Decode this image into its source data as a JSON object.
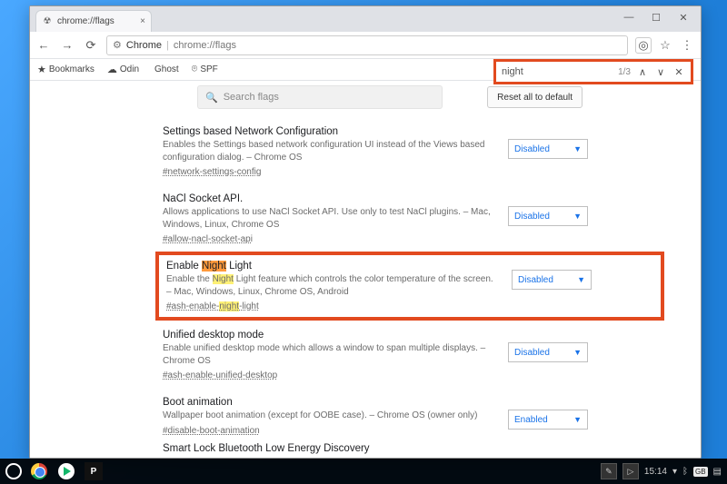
{
  "window": {
    "tab_title": "chrome://flags"
  },
  "omnibox": {
    "scheme_icon": "⚙",
    "scheme": "Chrome",
    "separator": "|",
    "path": "chrome://flags"
  },
  "bookmarks": {
    "label": "Bookmarks",
    "items": [
      {
        "icon": "☁",
        "label": "Odin"
      },
      {
        "icon": "",
        "label": "Ghost"
      },
      {
        "icon": "⌾",
        "label": "SPF"
      }
    ]
  },
  "find": {
    "query": "night",
    "count": "1/3"
  },
  "search": {
    "placeholder": "Search flags"
  },
  "reset_label": "Reset all to default",
  "flags": [
    {
      "title": "Settings based Network Configuration",
      "desc": "Enables the Settings based network configuration UI instead of the Views based configuration dialog. – Chrome OS",
      "link": "#network-settings-config",
      "value": "Disabled"
    },
    {
      "title": "NaCl Socket API.",
      "desc": "Allows applications to use NaCl Socket API. Use only to test NaCl plugins. – Mac, Windows, Linux, Chrome OS",
      "link": "#allow-nacl-socket-api",
      "value": "Disabled"
    },
    {
      "title_pre": "Enable ",
      "title_hl": "Night",
      "title_post": " Light",
      "desc_pre": "Enable the ",
      "desc_hl": "Night",
      "desc_post": " Light feature which controls the color temperature of the screen. – Mac, Windows, Linux, Chrome OS, Android",
      "link_pre": "#ash-enable-",
      "link_hl": "night",
      "link_post": "-light",
      "value": "Disabled"
    },
    {
      "title": "Unified desktop mode",
      "desc": "Enable unified desktop mode which allows a window to span multiple displays. – Chrome OS",
      "link": "#ash-enable-unified-desktop",
      "value": "Disabled"
    },
    {
      "title": "Boot animation",
      "desc": "Wallpaper boot animation (except for OOBE case). – Chrome OS (owner only)",
      "link": "#disable-boot-animation",
      "value": "Enabled"
    }
  ],
  "cutoff_title": "Smart Lock Bluetooth Low Energy Discovery",
  "taskbar": {
    "time": "15:14",
    "lang": "GB"
  }
}
